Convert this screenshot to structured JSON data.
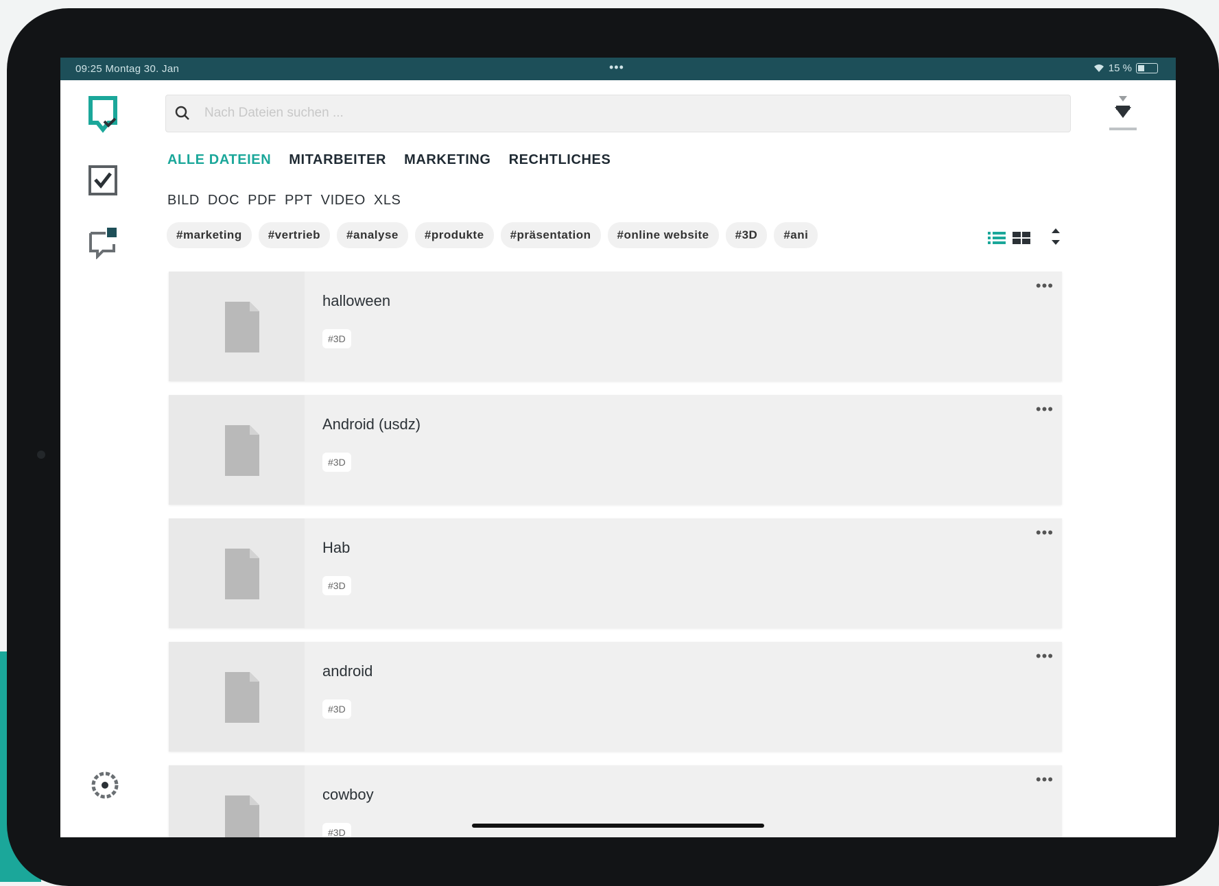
{
  "status_bar": {
    "time_date": "09:25  Montag 30. Jan",
    "center": "•••",
    "right": "15 %"
  },
  "search": {
    "placeholder": "Nach Dateien suchen ..."
  },
  "tabs": [
    {
      "label": "ALLE DATEIEN",
      "active": true
    },
    {
      "label": "MITARBEITER",
      "active": false
    },
    {
      "label": "MARKETING",
      "active": false
    },
    {
      "label": "RECHTLICHES",
      "active": false
    }
  ],
  "file_types": [
    "BILD",
    "DOC",
    "PDF",
    "PPT",
    "VIDEO",
    "XLS"
  ],
  "tags": [
    "#marketing",
    "#vertrieb",
    "#analyse",
    "#produkte",
    "#präsentation",
    "#online website",
    "#3D",
    "#ani"
  ],
  "files": [
    {
      "name": "halloween",
      "tag": "#3D"
    },
    {
      "name": "Android (usdz)",
      "tag": "#3D"
    },
    {
      "name": "Hab",
      "tag": "#3D"
    },
    {
      "name": "android",
      "tag": "#3D"
    },
    {
      "name": "cowboy",
      "tag": "#3D"
    }
  ],
  "more_label": "•••",
  "colors": {
    "accent": "#1ba79a",
    "status_bar": "#1d4f59",
    "frame": "#121416"
  },
  "icons": [
    "logo-icon",
    "tasks-icon",
    "chat-icon",
    "settings-icon",
    "search-icon",
    "download-icon",
    "list-view-icon",
    "grid-view-icon",
    "sort-icon",
    "document-icon"
  ]
}
